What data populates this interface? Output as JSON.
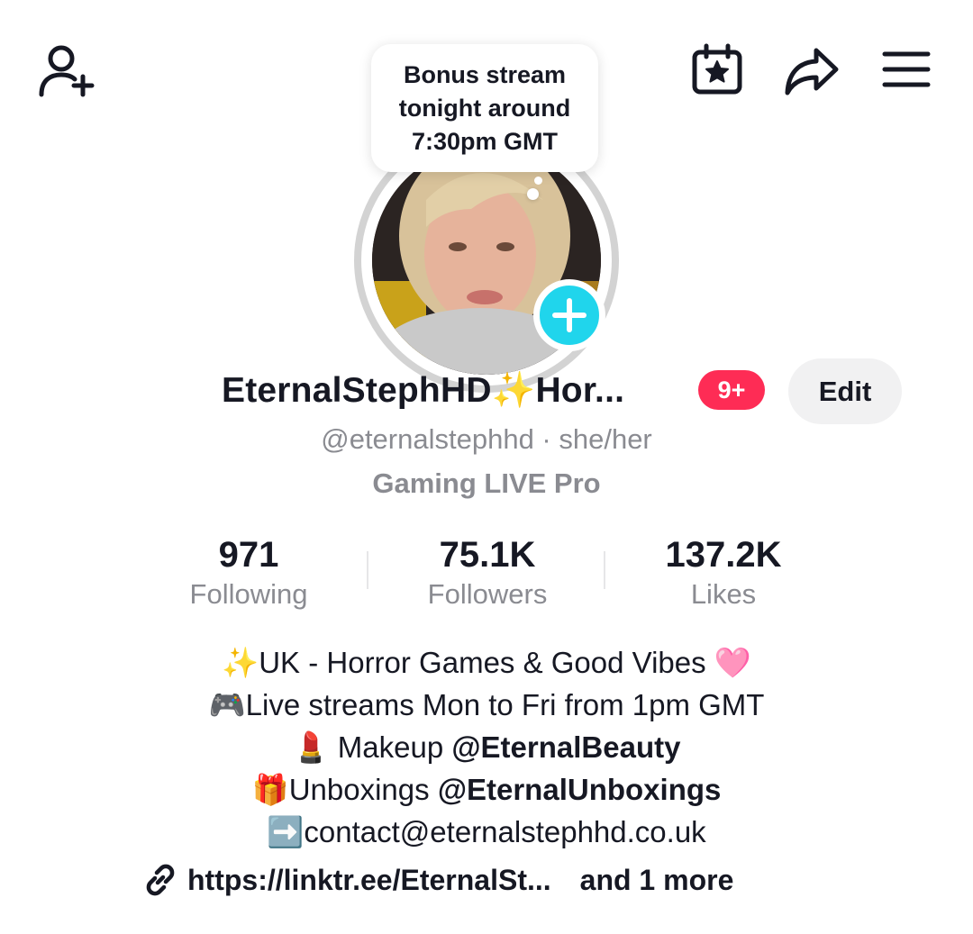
{
  "bubble": {
    "text": "Bonus stream\ntonight around\n7:30pm GMT"
  },
  "profile": {
    "display_name": "EternalStephHD✨Hor...",
    "notification_badge": "9+",
    "edit_label": "Edit",
    "handle": "@eternalstephhd · she/her",
    "pro_label": "Gaming LIVE Pro"
  },
  "stats": [
    {
      "value": "971",
      "label": "Following"
    },
    {
      "value": "75.1K",
      "label": "Followers"
    },
    {
      "value": "137.2K",
      "label": "Likes"
    }
  ],
  "bio": {
    "line1": "✨UK - Horror Games & Good Vibes 🩷",
    "line2": "🎮Live streams Mon to Fri from 1pm GMT",
    "line3_prefix": "💄 Makeup ",
    "line3_mention": "@EternalBeauty",
    "line4_prefix": "🎁Unboxings ",
    "line4_mention": "@EternalUnboxings",
    "line5": "➡️contact@eternalstephhd.co.uk"
  },
  "link": {
    "url": "https://linktr.ee/EternalSt...",
    "more": "and 1 more"
  },
  "icons": {
    "add_friend": "person-add-icon",
    "events": "calendar-star-icon",
    "share": "share-arrow-icon",
    "menu": "hamburger-menu-icon",
    "link": "link-chain-icon",
    "add_avatar": "plus-icon"
  },
  "colors": {
    "accent_cyan": "#20d5ec",
    "badge_red": "#fe2c55",
    "muted_text": "#8a8b91",
    "edit_bg": "#f1f1f2"
  }
}
